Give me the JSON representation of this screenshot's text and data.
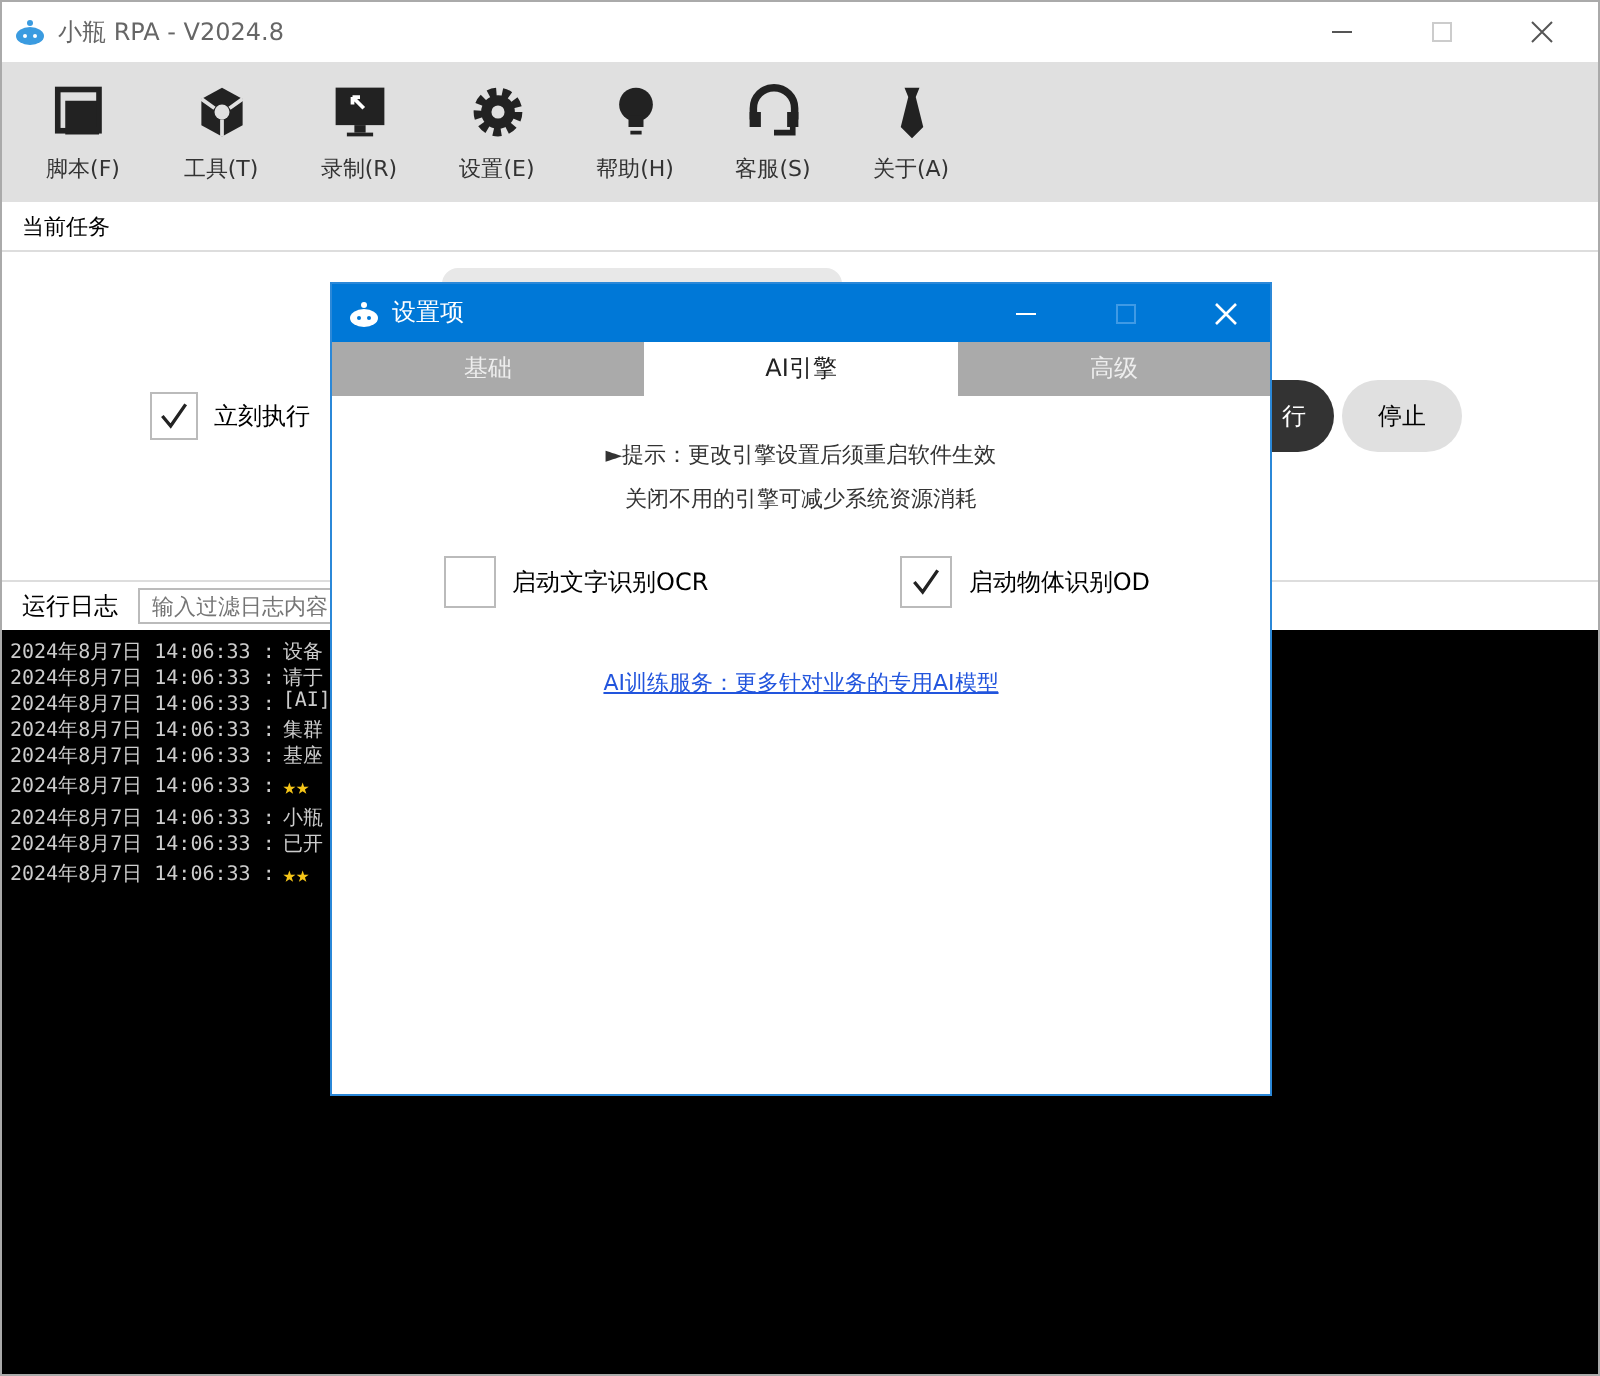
{
  "window": {
    "title": "小瓶 RPA - V2024.8"
  },
  "toolbar": [
    {
      "label": "脚本(F)",
      "kind": "script"
    },
    {
      "label": "工具(T)",
      "kind": "tools"
    },
    {
      "label": "录制(R)",
      "kind": "record"
    },
    {
      "label": "设置(E)",
      "kind": "settings"
    },
    {
      "label": "帮助(H)",
      "kind": "help"
    },
    {
      "label": "客服(S)",
      "kind": "support"
    },
    {
      "label": "关于(A)",
      "kind": "about"
    }
  ],
  "task": {
    "heading": "当前任务",
    "run_now": {
      "label": "立刻执行",
      "checked": true
    },
    "run_button": "行",
    "stop_button": "停止"
  },
  "log": {
    "heading": "运行日志",
    "filter_placeholder": "输入过滤日志内容",
    "lines": [
      {
        "time": "2024年8月7日 14:06:33 :",
        "message": "设备",
        "kind": "text"
      },
      {
        "time": "2024年8月7日 14:06:33 :",
        "message": "请于",
        "kind": "text"
      },
      {
        "time": "2024年8月7日 14:06:33 :",
        "message": "[AI]",
        "kind": "text"
      },
      {
        "time": "2024年8月7日 14:06:33 :",
        "message": "集群",
        "kind": "text"
      },
      {
        "time": "2024年8月7日 14:06:33 :",
        "message": "基座",
        "kind": "text"
      },
      {
        "time": "2024年8月7日 14:06:33 :",
        "message": "★★",
        "kind": "highlight"
      },
      {
        "time": "2024年8月7日 14:06:33 :",
        "message": "小瓶",
        "kind": "text"
      },
      {
        "time": "2024年8月7日 14:06:33 :",
        "message": "已开",
        "kind": "text"
      },
      {
        "time": "2024年8月7日 14:06:33 :",
        "message": "★★",
        "kind": "highlight"
      }
    ]
  },
  "dialog": {
    "title": "设置项",
    "tabs": [
      {
        "label": "基础",
        "selected": false
      },
      {
        "label": "AI引擎",
        "selected": true
      },
      {
        "label": "高级",
        "selected": false
      }
    ],
    "hint_lines": [
      "►提示：更改引擎设置后须重启软件生效",
      "关闭不用的引擎可减少系统资源消耗"
    ],
    "options": [
      {
        "label": "启动文字识别OCR",
        "checked": false
      },
      {
        "label": "启动物体识别OD",
        "checked": true
      }
    ],
    "link": "AI训练服务：更多针对业务的专用AI模型"
  }
}
